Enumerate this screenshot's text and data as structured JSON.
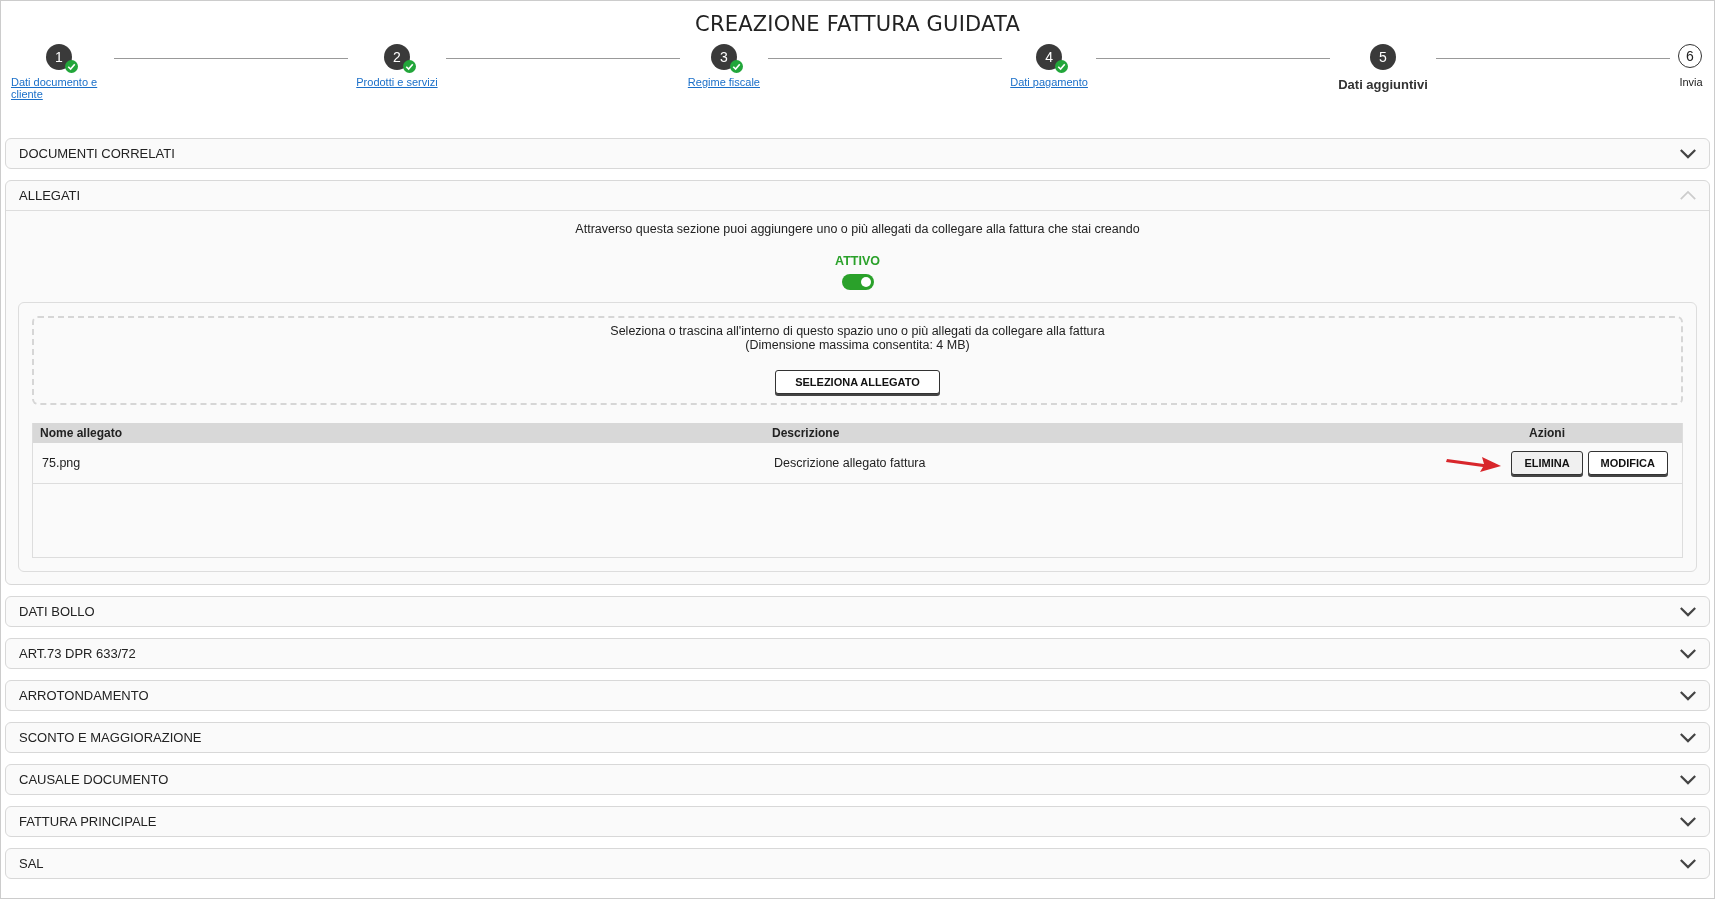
{
  "title": "CREAZIONE FATTURA GUIDATA",
  "steps": [
    {
      "number": "1",
      "label": "Dati documento e cliente",
      "completed": true,
      "selected": false
    },
    {
      "number": "2",
      "label": "Prodotti e servizi",
      "completed": true,
      "selected": false
    },
    {
      "number": "3",
      "label": "Regime fiscale",
      "completed": true,
      "selected": false
    },
    {
      "number": "4",
      "label": "Dati pagamento",
      "completed": true,
      "selected": false
    },
    {
      "number": "5",
      "label": "Dati aggiuntivi",
      "completed": false,
      "selected": true
    },
    {
      "number": "6",
      "label": "Invia",
      "completed": false,
      "selected": false
    }
  ],
  "sections": [
    {
      "title": "DOCUMENTI CORRELATI",
      "expanded": false
    },
    {
      "title": "ALLEGATI",
      "expanded": true
    },
    {
      "title": "DATI BOLLO",
      "expanded": false
    },
    {
      "title": "ART.73 DPR 633/72",
      "expanded": false
    },
    {
      "title": "ARROTONDAMENTO",
      "expanded": false
    },
    {
      "title": "SCONTO E MAGGIORAZIONE",
      "expanded": false
    },
    {
      "title": "CAUSALE DOCUMENTO",
      "expanded": false
    },
    {
      "title": "FATTURA PRINCIPALE",
      "expanded": false
    },
    {
      "title": "SAL",
      "expanded": false
    }
  ],
  "attachments": {
    "intro": "Attraverso questa sezione puoi aggiungere uno o più allegati da collegare alla fattura che stai creando",
    "toggle": {
      "label": "ATTIVO",
      "on": true
    },
    "dropzone": {
      "text": "Seleziona o trascina all'interno di questo spazio uno o più allegati da collegare alla fattura",
      "limit": "(Dimensione massima consentita: 4 MB)",
      "button": "SELEZIONA ALLEGATO"
    },
    "table": {
      "columns": [
        "Nome allegato",
        "Descrizione",
        "Azioni"
      ],
      "rows": [
        {
          "name": "75.png",
          "description": "Descrizione allegato fattura",
          "actions": [
            "ELIMINA",
            "MODIFICA"
          ]
        }
      ]
    }
  }
}
